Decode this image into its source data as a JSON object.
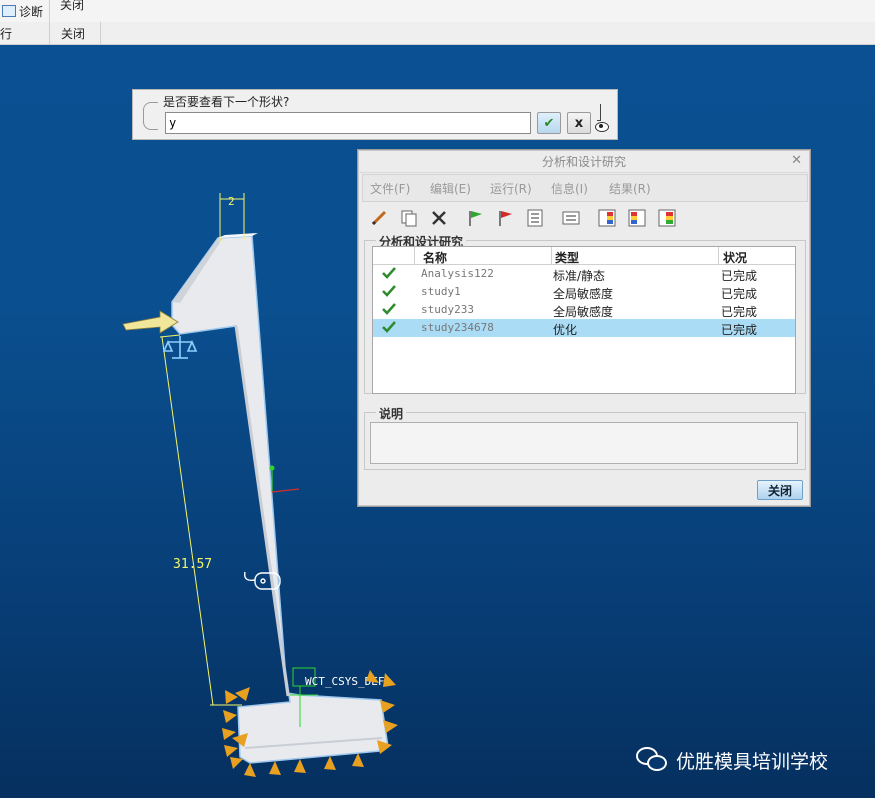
{
  "topbar": {
    "row1": {
      "diagnose_label": "诊断",
      "close_label": "关闭"
    },
    "row2": {
      "left_label": "行",
      "close_label": "关闭"
    }
  },
  "prompt": {
    "question": "是否要查看下一个形状?",
    "input_value": "y"
  },
  "dialog": {
    "title": "分析和设计研究",
    "menu": [
      "文件(F)",
      "编辑(E)",
      "运行(R)",
      "信息(I)",
      "结果(R)"
    ],
    "toolbar_icons": [
      "pencil-icon",
      "copy-icon",
      "delete-icon",
      "green-flag-icon",
      "red-flag-icon",
      "list-icon",
      "report-icon",
      "results-icon",
      "results-compare-icon",
      "results-chart-icon"
    ],
    "group_label": "分析和设计研究",
    "columns": [
      "名称",
      "类型",
      "状况"
    ],
    "rows": [
      {
        "name": "Analysis122",
        "type": "标准/静态",
        "status": "已完成"
      },
      {
        "name": "study1",
        "type": "全局敏感度",
        "status": "已完成"
      },
      {
        "name": "study233",
        "type": "全局敏感度",
        "status": "已完成"
      },
      {
        "name": "study234678",
        "type": "优化",
        "status": "已完成"
      }
    ],
    "selected_row": 3,
    "description_label": "说明",
    "description_value": "",
    "close_button": "关闭"
  },
  "model": {
    "dimension_top": "2",
    "dimension_length": "31.57",
    "csys_label": "WCT_CSYS_DEF"
  },
  "watermark": "优胜模具培训学校",
  "colors": {
    "viewport_top": "#0a5092",
    "viewport_bottom": "#05305f",
    "selection": "#aadcf6",
    "check_green": "#2e8b2e",
    "dimension_yellow": "#f5f56a"
  }
}
